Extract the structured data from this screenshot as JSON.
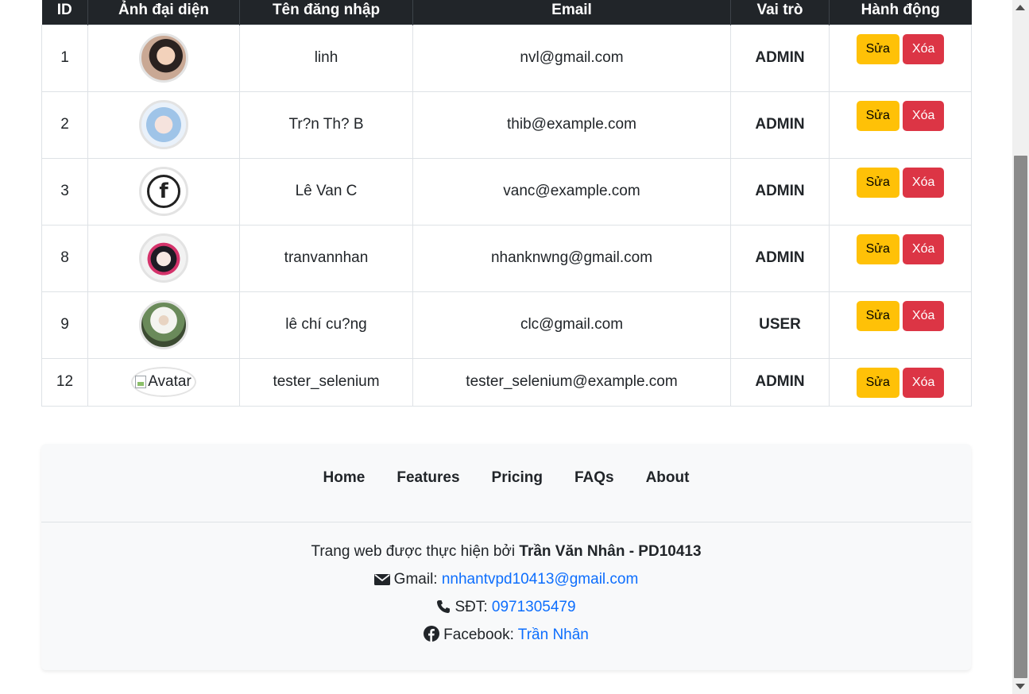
{
  "table": {
    "headers": [
      "ID",
      "Ảnh đại diện",
      "Tên đăng nhập",
      "Email",
      "Vai trò",
      "Hành động"
    ],
    "rows": [
      {
        "id": "1",
        "username": "linh",
        "email": "nvl@gmail.com",
        "role": "ADMIN",
        "avatar": "photo-avatar"
      },
      {
        "id": "2",
        "username": "Tr?n Th? B",
        "email": "thib@example.com",
        "role": "ADMIN",
        "avatar": "anime-avatar"
      },
      {
        "id": "3",
        "username": "Lê Van C",
        "email": "vanc@example.com",
        "role": "ADMIN",
        "avatar": "facebook-logo-avatar"
      },
      {
        "id": "8",
        "username": "tranvannhan",
        "email": "nhanknwng@gmail.com",
        "role": "ADMIN",
        "avatar": "anime-avatar"
      },
      {
        "id": "9",
        "username": "lê chí cu?ng",
        "email": "clc@gmail.com",
        "role": "USER",
        "avatar": "photo-avatar"
      },
      {
        "id": "12",
        "username": "tester_selenium",
        "email": "tester_selenium@example.com",
        "role": "ADMIN",
        "avatar": "broken-image",
        "avatar_alt": "Avatar"
      }
    ],
    "edit_label": "Sửa",
    "delete_label": "Xóa"
  },
  "footer": {
    "nav": [
      "Home",
      "Features",
      "Pricing",
      "FAQs",
      "About"
    ],
    "credit_prefix": "Trang web được thực hiện bởi ",
    "credit_name": "Trần Văn Nhân - PD10413",
    "gmail_label": "Gmail: ",
    "gmail_value": "nnhantvpd10413@gmail.com",
    "phone_label": "SĐT: ",
    "phone_value": "0971305479",
    "facebook_label": "Facebook: ",
    "facebook_value": "Trần Nhân"
  },
  "colors": {
    "header_bg": "#212529",
    "edit_button": "#ffc107",
    "delete_button": "#dc3545",
    "link": "#0d6efd",
    "footer_bg": "#f8f9fa"
  }
}
